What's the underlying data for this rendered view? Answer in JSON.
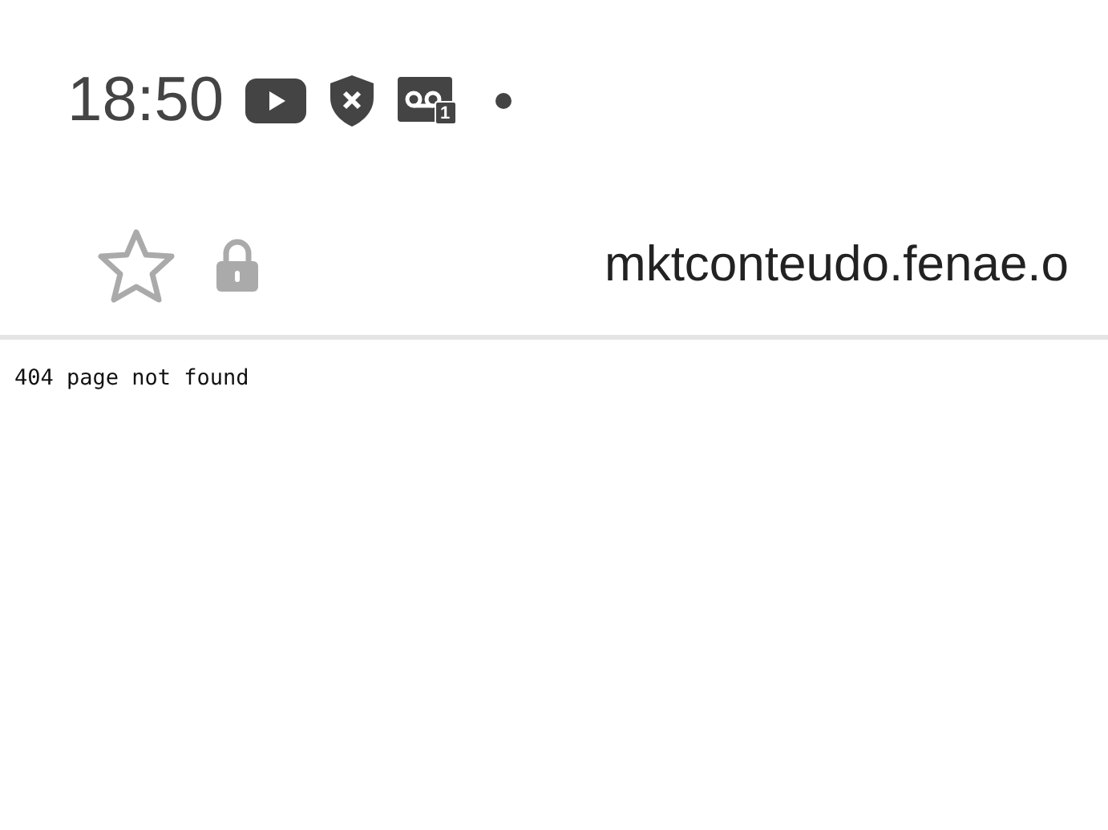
{
  "status_bar": {
    "time": "18:50",
    "voicemail_count": "1"
  },
  "address_bar": {
    "url": "mktconteudo.fenae.o",
    "bookmarked": false,
    "secure": true
  },
  "page": {
    "text": "404 page not found"
  }
}
